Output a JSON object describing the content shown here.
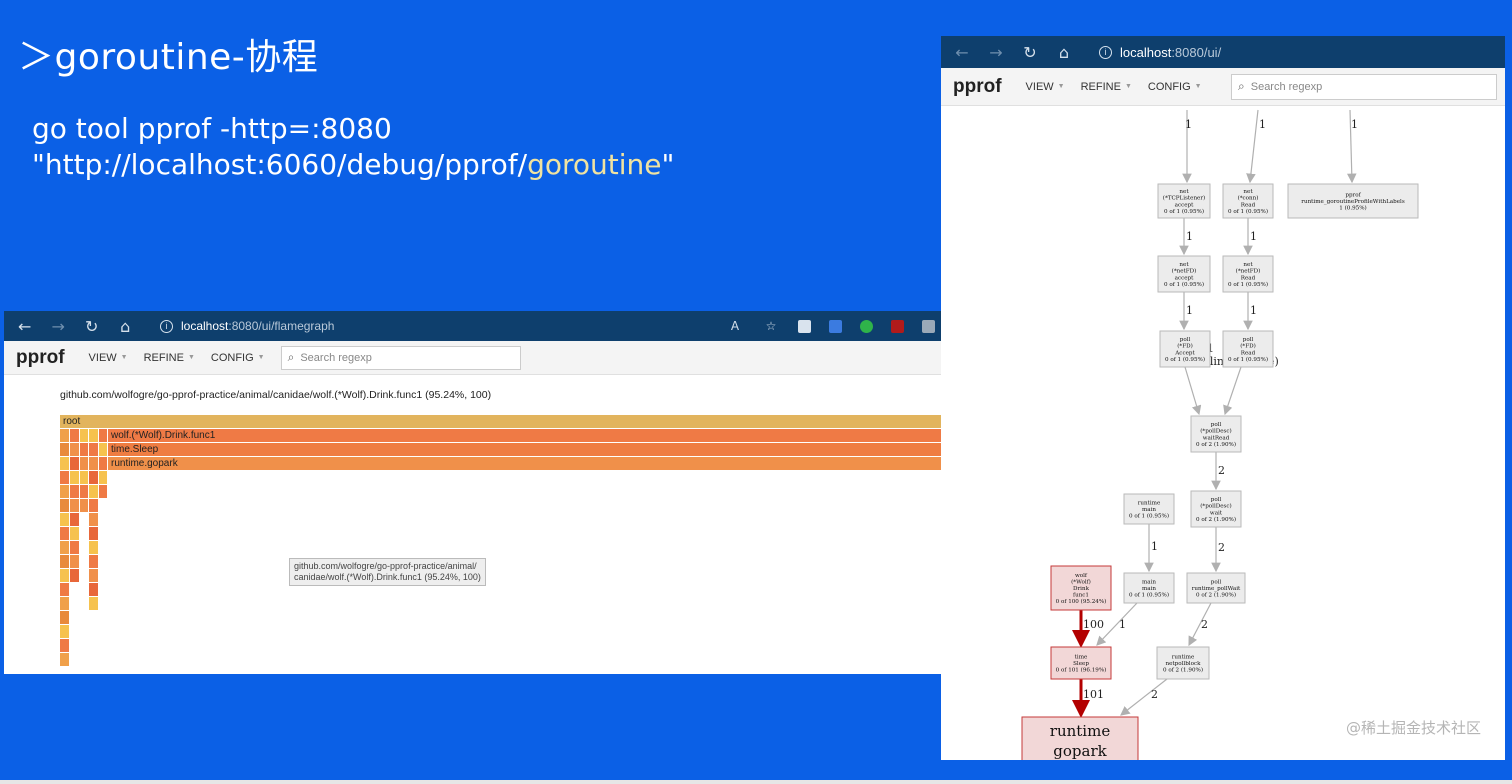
{
  "slide": {
    "title": "＞goroutine-协程",
    "cmd_line1": "go tool pprof -http=:8080",
    "cmd_line2_prefix": "\"http://localhost:6060/debug/pprof/",
    "cmd_line2_highlight": "goroutine",
    "cmd_line2_suffix": "\""
  },
  "flame_window": {
    "url_host": "localhost",
    "url_path": ":8080/ui/flamegraph",
    "logo": "pprof",
    "menu": [
      "VIEW",
      "REFINE",
      "CONFIG"
    ],
    "search_placeholder": "Search regexp",
    "header": "github.com/wolfogre/go-pprof-practice/animal/canidae/wolf.(*Wolf).Drink.func1 (95.24%, 100)",
    "bars": {
      "root": "root",
      "drink": "wolf.(*Wolf).Drink.func1",
      "sleep": "time.Sleep",
      "gopark": "runtime.gopark"
    },
    "tooltip_line1": "github.com/wolfogre/go-pprof-practice/animal/",
    "tooltip_line2": "canidae/wolf.(*Wolf).Drink.func1 (95.24%, 100)"
  },
  "graph_window": {
    "url_host": "localhost",
    "url_path": ":8080/ui/",
    "logo": "pprof",
    "menu": [
      "VIEW",
      "REFINE",
      "CONFIG"
    ],
    "search_placeholder": "Search regexp",
    "nodes": {
      "tcp_accept": [
        "net",
        "(*TCPListener)",
        "accept",
        "0 of 1 (0.95%)"
      ],
      "conn_read": [
        "net",
        "(*conn)",
        "Read",
        "0 of 1 (0.95%)"
      ],
      "pprof_labels": [
        "pprof",
        "runtime_goroutineProfileWithLabels",
        "1 (0.95%)"
      ],
      "netfd_accept": [
        "net",
        "(*netFD)",
        "accept",
        "0 of 1 (0.95%)"
      ],
      "netfd_read": [
        "net",
        "(*netFD)",
        "Read",
        "0 of 1 (0.95%)"
      ],
      "fd_accept": [
        "poll",
        "(*FD)",
        "Accept",
        "0 of 1 (0.95%)"
      ],
      "fd_read": [
        "poll",
        "(*FD)",
        "Read",
        "0 of 1 (0.95%)"
      ],
      "waitread": [
        "poll",
        "(*pollDesc)",
        "waitRead",
        "0 of 2 (1.90%)"
      ],
      "runtime_main": [
        "runtime",
        "main",
        "0 of 1 (0.95%)"
      ],
      "polldesc_wait": [
        "poll",
        "(*pollDesc)",
        "wait",
        "0 of 2 (1.90%)"
      ],
      "wolf_drink": [
        "wolf",
        "(*Wolf)",
        "Drink",
        "func1",
        "0 of 100 (95.24%)"
      ],
      "main_main": [
        "main",
        "main",
        "0 of 1 (0.95%)"
      ],
      "poll_wait": [
        "poll",
        "runtime_pollWait",
        "0 of 2 (1.90%)"
      ],
      "time_sleep": [
        "time",
        "Sleep",
        "0 of 101 (96.19%)"
      ],
      "netpollblock": [
        "runtime",
        "netpollblock",
        "0 of 2 (1.90%)"
      ],
      "gopark": [
        "runtime",
        "gopark",
        "103 (98.10%)"
      ]
    },
    "edge_labels": {
      "in_tcp": "1",
      "in_conn": "1",
      "in_pprof": "1",
      "tcp_netfd": "1",
      "conn_netfd": "1",
      "netfd_fd_accept": "1",
      "netfd_fd_read": "1",
      "fd_accept_wait": "1",
      "fd_read_wait": "1",
      "inline": "(inline)",
      "waitread_wait": "2",
      "rtmain_main": "1",
      "wait_pollwait": "2",
      "drink_sleep": "100",
      "main_sleep": "1",
      "pollwait_netpoll": "2",
      "sleep_gopark": "101",
      "netpoll_gopark": "2"
    },
    "watermark": "@稀土掘金技术社区"
  },
  "colors": {
    "background": "#0b60e6",
    "hot_edge": "#b30000",
    "hot_node_fill": "#f2d7d7",
    "hot_node_border": "#c43a3a"
  }
}
